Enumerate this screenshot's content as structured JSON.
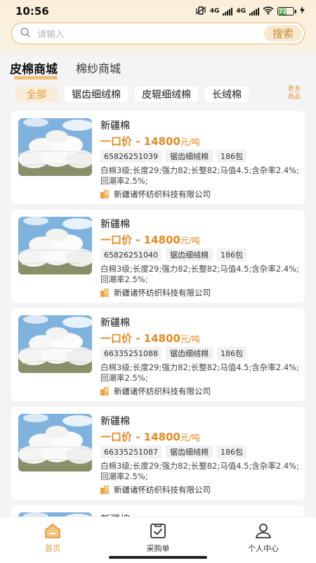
{
  "status": {
    "time": "10:56",
    "net1": "4G",
    "net2": "4G",
    "battery": "72"
  },
  "search": {
    "placeholder": "请输入",
    "button": "搜索"
  },
  "tabs": [
    {
      "label": "皮棉商城"
    },
    {
      "label": "棉纱商城"
    }
  ],
  "chips": [
    {
      "label": "全部"
    },
    {
      "label": "锯齿细绒棉"
    },
    {
      "label": "皮辊细绒棉"
    },
    {
      "label": "长绒棉"
    }
  ],
  "more": {
    "label": "更多商品"
  },
  "products": [
    {
      "name": "新疆棉",
      "price_prefix": "一口价 - ",
      "price": "14800",
      "unit": "元/吨",
      "tags": [
        "65826251039",
        "锯齿细绒棉",
        "186包"
      ],
      "desc": "白棉3级;长度29;强力82;长整82;马值4.5;含杂率2.4%;回潮率2.5%;",
      "company": "新疆诸怀纺织科技有限公司"
    },
    {
      "name": "新疆棉",
      "price_prefix": "一口价 - ",
      "price": "14800",
      "unit": "元/吨",
      "tags": [
        "65826251040",
        "锯齿细绒棉",
        "186包"
      ],
      "desc": "白棉3级;长度29;强力82;长整82;马值4.5;含杂率2.4%;回潮率2.5%;",
      "company": "新疆诸怀纺织科技有限公司"
    },
    {
      "name": "新疆棉",
      "price_prefix": "一口价 - ",
      "price": "14800",
      "unit": "元/吨",
      "tags": [
        "66335251088",
        "锯齿细绒棉",
        "186包"
      ],
      "desc": "白棉3级;长度29;强力82;长整82;马值4.5;含杂率2.4%;回潮率2.5%;",
      "company": "新疆诸怀纺织科技有限公司"
    },
    {
      "name": "新疆棉",
      "price_prefix": "一口价 - ",
      "price": "14800",
      "unit": "元/吨",
      "tags": [
        "66335251087",
        "锯齿细绒棉",
        "186包"
      ],
      "desc": "白棉3级;长度29;强力82;长整82;马值4.5;含杂率2.4%;回潮率2.5%;",
      "company": "新疆诸怀纺织科技有限公司"
    },
    {
      "name": "新疆棉"
    }
  ],
  "bottom_nav": [
    {
      "label": "首页",
      "icon": "home-icon"
    },
    {
      "label": "采购单",
      "icon": "order-icon"
    },
    {
      "label": "个人中心",
      "icon": "user-icon"
    }
  ],
  "colors": {
    "accent": "#e09a3c",
    "price": "#e58a22",
    "search_border": "#e9b565"
  }
}
